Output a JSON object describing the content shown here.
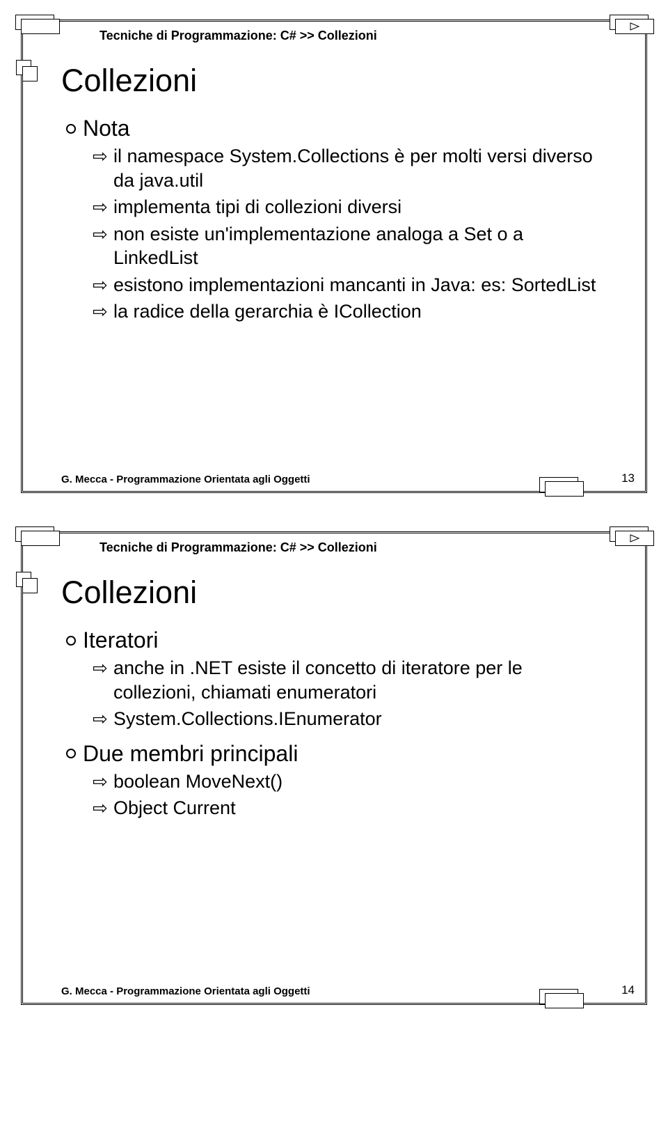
{
  "slides": [
    {
      "header": "Tecniche di Programmazione: C# >> Collezioni",
      "title": "Collezioni",
      "items": [
        {
          "label": "Nota",
          "subitems": [
            "il namespace System.Collections è per molti versi diverso da java.util",
            "implementa tipi di collezioni diversi",
            "non esiste un'implementazione analoga a Set o a LinkedList",
            "esistono implementazioni mancanti in Java: es: SortedList",
            "la radice della gerarchia è ICollection"
          ]
        }
      ],
      "footer": "G. Mecca - Programmazione Orientata agli Oggetti",
      "page": "13"
    },
    {
      "header": "Tecniche di Programmazione: C# >> Collezioni",
      "title": "Collezioni",
      "items": [
        {
          "label": "Iteratori",
          "subitems": [
            "anche in .NET esiste il concetto di iteratore per le collezioni, chiamati enumeratori",
            "System.Collections.IEnumerator"
          ]
        },
        {
          "label": "Due membri principali",
          "subitems": [
            "boolean MoveNext()",
            "Object Current"
          ]
        }
      ],
      "footer": "G. Mecca - Programmazione Orientata agli Oggetti",
      "page": "14"
    }
  ]
}
